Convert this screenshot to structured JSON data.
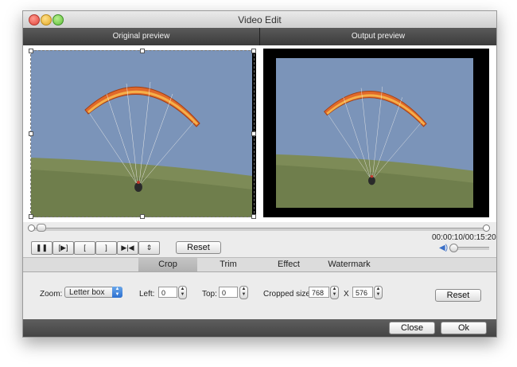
{
  "window": {
    "title": "Video Edit"
  },
  "preview": {
    "original_label": "Original preview",
    "output_label": "Output preview"
  },
  "controls": {
    "pause_icon": "pause-icon",
    "step_icon": "play-frame-icon",
    "mark_in": "[",
    "mark_out": "]",
    "reset_label": "Reset",
    "time": "00:00:10/00:15:20",
    "timeline_position": 0.01
  },
  "tabs": [
    {
      "label": "Crop",
      "active": true
    },
    {
      "label": "Trim",
      "active": false
    },
    {
      "label": "Effect",
      "active": false
    },
    {
      "label": "Watermark",
      "active": false
    }
  ],
  "crop": {
    "zoom_label": "Zoom:",
    "zoom_value": "Letter box",
    "left_label": "Left:",
    "left_value": "0",
    "top_label": "Top:",
    "top_value": "0",
    "cropped_label": "Cropped size:",
    "width_value": "768",
    "x_sep": "X",
    "height_value": "576",
    "reset_label": "Reset"
  },
  "footer": {
    "close_label": "Close",
    "ok_label": "Ok"
  },
  "colors": {
    "sky": "#7a93b8",
    "grass": "#7b8a55",
    "wing": "#d9652a",
    "header_dark": "#3b3b3b"
  }
}
